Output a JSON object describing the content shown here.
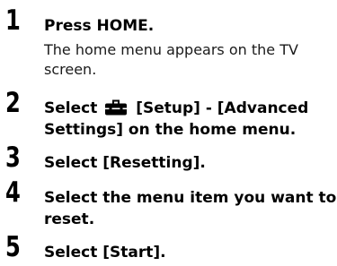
{
  "steps": [
    {
      "number": "1",
      "text": "Press HOME.",
      "description_line1": "The home menu appears on the TV",
      "description_line2": "screen."
    },
    {
      "number": "2",
      "text_before_icon": "Select",
      "icon": "toolbox-icon",
      "text_after_icon": "[Setup] - [Advanced",
      "text_line2": "Settings] on the home menu."
    },
    {
      "number": "3",
      "text": "Select [Resetting]."
    },
    {
      "number": "4",
      "text_line1": "Select the menu item you want to",
      "text_line2": "reset."
    },
    {
      "number": "5",
      "text": "Select [Start]."
    }
  ]
}
